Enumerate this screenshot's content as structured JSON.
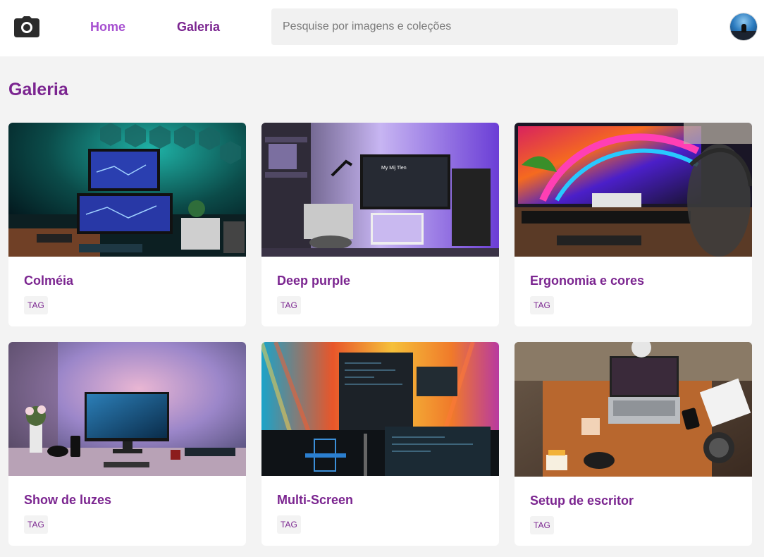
{
  "header": {
    "logo_icon": "camera-icon",
    "nav": {
      "home": "Home",
      "gallery": "Galeria"
    },
    "search": {
      "placeholder": "Pesquise por imagens e coleções",
      "value": ""
    },
    "avatar_icon": "user-avatar"
  },
  "page": {
    "title": "Galeria"
  },
  "gallery": {
    "cards": [
      {
        "title": "Colméia",
        "tag": "TAG"
      },
      {
        "title": "Deep purple",
        "tag": "TAG"
      },
      {
        "title": "Ergonomia e cores",
        "tag": "TAG"
      },
      {
        "title": "Show de luzes",
        "tag": "TAG"
      },
      {
        "title": "Multi-Screen",
        "tag": "TAG"
      },
      {
        "title": "Setup de escritor",
        "tag": "TAG"
      }
    ]
  },
  "colors": {
    "accent": "#7b2590",
    "accent_light": "#a64fd0",
    "background": "#f3f3f3",
    "card": "#ffffff"
  }
}
